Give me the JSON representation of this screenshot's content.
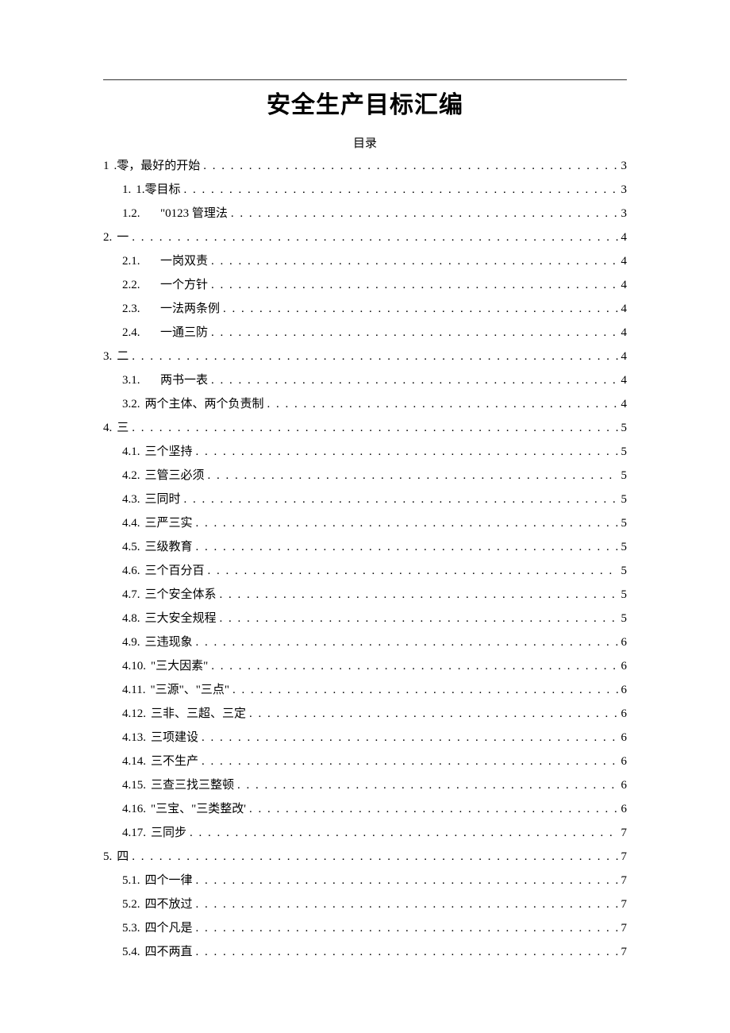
{
  "document": {
    "title": "安全生产目标汇编",
    "toc_label": "目录"
  },
  "toc": [
    {
      "level": 0,
      "num": "1",
      "numStyle": "plain",
      "text": ".零，最好的开始",
      "page": "3"
    },
    {
      "level": 1,
      "num": "1.",
      "numStyle": "plain",
      "text": "1.零目标",
      "page": "3"
    },
    {
      "level": 1,
      "num": "1.2.",
      "numStyle": "wide",
      "text": "\"0123 管理法",
      "page": "3"
    },
    {
      "level": 0,
      "num": "2.",
      "numStyle": "plain",
      "text": "一",
      "page": "4"
    },
    {
      "level": 1,
      "num": "2.1.",
      "numStyle": "wide",
      "text": "一岗双责",
      "page": "4"
    },
    {
      "level": 1,
      "num": "2.2.",
      "numStyle": "wide",
      "text": "一个方针",
      "page": "4"
    },
    {
      "level": 1,
      "num": "2.3.",
      "numStyle": "wide",
      "text": "一法两条例",
      "page": "4"
    },
    {
      "level": 1,
      "num": "2.4.",
      "numStyle": "wide",
      "text": "一通三防",
      "page": "4"
    },
    {
      "level": 0,
      "num": "3.",
      "numStyle": "plain",
      "text": "二",
      "page": "4"
    },
    {
      "level": 1,
      "num": "3.1.",
      "numStyle": "wide",
      "text": "两书一表",
      "page": "4"
    },
    {
      "level": 1,
      "num": "3.2.",
      "numStyle": "plain",
      "text": "两个主体、两个负责制",
      "page": "4"
    },
    {
      "level": 0,
      "num": "4.",
      "numStyle": "plain",
      "text": "三",
      "page": "5"
    },
    {
      "level": 1,
      "num": "4.1.",
      "numStyle": "plain",
      "text": "三个坚持",
      "page": "5"
    },
    {
      "level": 1,
      "num": "4.2.",
      "numStyle": "plain",
      "text": "三管三必须",
      "page": "5"
    },
    {
      "level": 1,
      "num": "4.3.",
      "numStyle": "plain",
      "text": "三同时",
      "page": "5"
    },
    {
      "level": 1,
      "num": "4.4.",
      "numStyle": "plain",
      "text": "三严三实",
      "page": "5"
    },
    {
      "level": 1,
      "num": "4.5.",
      "numStyle": "plain",
      "text": "三级教育",
      "page": "5"
    },
    {
      "level": 1,
      "num": "4.6.",
      "numStyle": "plain",
      "text": "三个百分百",
      "page": "5"
    },
    {
      "level": 1,
      "num": "4.7.",
      "numStyle": "plain",
      "text": "三个安全体系",
      "page": "5"
    },
    {
      "level": 1,
      "num": "4.8.",
      "numStyle": "plain",
      "text": "三大安全规程",
      "page": "5"
    },
    {
      "level": 1,
      "num": "4.9.",
      "numStyle": "plain",
      "text": "三违现象",
      "page": "6"
    },
    {
      "level": 1,
      "num": "4.10.",
      "numStyle": "plain",
      "text": "\"三大因素\"",
      "page": "6"
    },
    {
      "level": 1,
      "num": "4.11.",
      "numStyle": "plain",
      "text": "\"三源\"、\"三点\"",
      "page": "6"
    },
    {
      "level": 1,
      "num": "4.12.",
      "numStyle": "plain",
      "text": "三非、三超、三定",
      "page": "6"
    },
    {
      "level": 1,
      "num": "4.13.",
      "numStyle": "plain",
      "text": "三项建设",
      "page": "6"
    },
    {
      "level": 1,
      "num": "4.14.",
      "numStyle": "plain",
      "text": "三不生产",
      "page": "6"
    },
    {
      "level": 1,
      "num": "4.15.",
      "numStyle": "plain",
      "text": "三查三找三整顿",
      "page": "6"
    },
    {
      "level": 1,
      "num": "4.16.",
      "numStyle": "plain",
      "text": "\"三宝、\"三类整改'",
      "page": "6"
    },
    {
      "level": 1,
      "num": "4.17.",
      "numStyle": "plain",
      "text": "三同步",
      "page": "7"
    },
    {
      "level": 0,
      "num": "5.",
      "numStyle": "plain",
      "text": "四",
      "page": "7"
    },
    {
      "level": 1,
      "num": "5.1.",
      "numStyle": "plain",
      "text": "四个一律",
      "page": "7"
    },
    {
      "level": 1,
      "num": "5.2.",
      "numStyle": "plain",
      "text": "四不放过",
      "page": "7"
    },
    {
      "level": 1,
      "num": "5.3.",
      "numStyle": "plain",
      "text": "四个凡是",
      "page": "7"
    },
    {
      "level": 1,
      "num": "5.4.",
      "numStyle": "plain",
      "text": "四不两直",
      "page": "7"
    }
  ]
}
